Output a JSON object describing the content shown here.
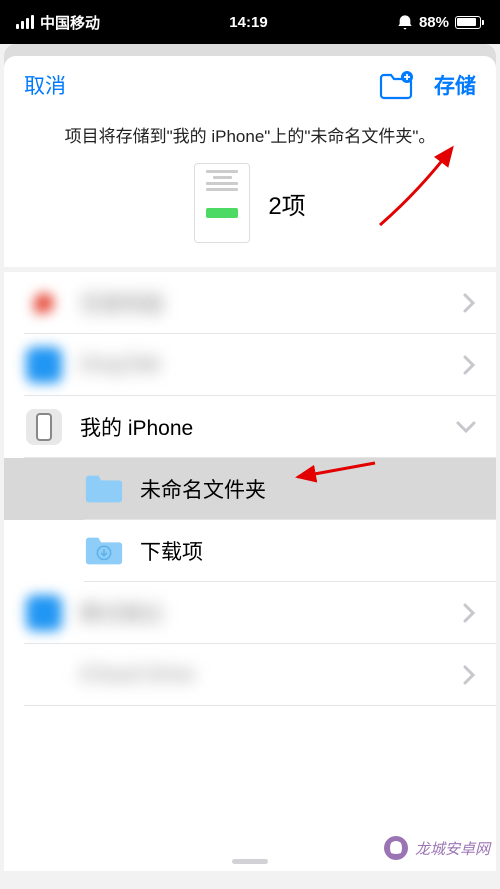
{
  "status_bar": {
    "carrier": "中国移动",
    "time": "14:19",
    "battery_percent": "88%"
  },
  "sheet": {
    "cancel": "取消",
    "save": "存储",
    "info_text": "项目将存储到\"我的 iPhone\"上的\"未命名文件夹\"。",
    "item_count": "2项"
  },
  "locations": [
    {
      "label": "百度网盘",
      "blurred": true
    },
    {
      "label": "DingTalk",
      "blurred": true
    },
    {
      "label": "我的 iPhone",
      "blurred": false,
      "expanded": true
    },
    {
      "label": "未命名文件夹",
      "blurred": false,
      "child": true,
      "selected": true
    },
    {
      "label": "下载项",
      "blurred": false,
      "child": true
    },
    {
      "label": "腾讯微云",
      "blurred": true
    },
    {
      "label": "iCloud Drive",
      "blurred": true
    }
  ],
  "watermark": "龙城安卓网"
}
